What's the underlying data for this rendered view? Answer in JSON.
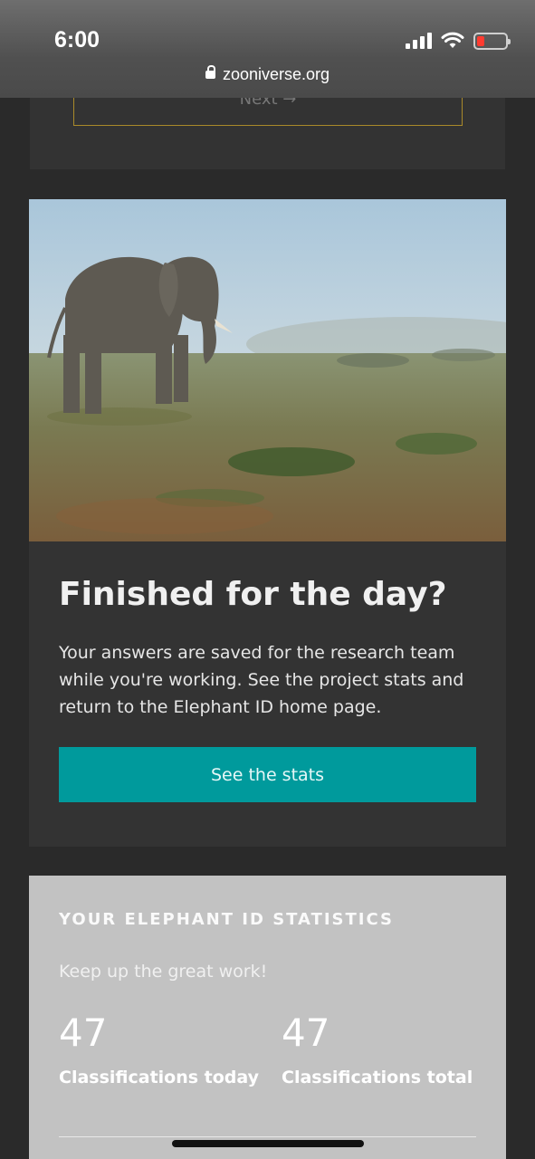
{
  "status_bar": {
    "time": "6:00",
    "url": "zooniverse.org"
  },
  "top_card": {
    "next_label": "Next →"
  },
  "finish_card": {
    "title": "Finished for the day?",
    "body": "Your answers are saved for the research team while you're working. See the project stats and return to the Elephant ID home page.",
    "button_label": "See the stats"
  },
  "stats_card": {
    "heading": "YOUR ELEPHANT ID STATISTICS",
    "subtitle": "Keep up the great work!",
    "today": {
      "value": "47",
      "label": "Classifications today"
    },
    "total": {
      "value": "47",
      "label": "Classifications total"
    }
  },
  "colors": {
    "accent": "#009a9c",
    "background": "#2a2a2a",
    "card": "#333333",
    "stats_card": "#c2c2c2"
  }
}
